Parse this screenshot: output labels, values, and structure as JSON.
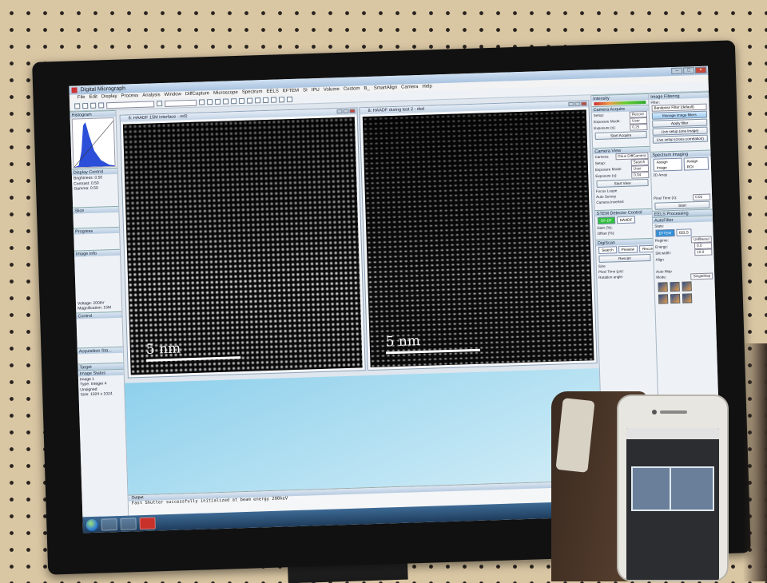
{
  "app": {
    "title": "Digital Micrograph",
    "menu": [
      "File",
      "Edit",
      "Display",
      "Process",
      "Analysis",
      "Window",
      "DiffCapture",
      "Microscope",
      "Spectrum",
      "EELS",
      "EFTEM",
      "SI",
      "IPU",
      "Volume",
      "Custom",
      "B_",
      "SmartAlign",
      "Camera",
      "Help"
    ]
  },
  "left_palettes": {
    "histogram": "Histogram",
    "display_control": "Display Control",
    "brightness": "Brightness: 0.50",
    "contrast": "Contrast: 0.50",
    "gamma": "Gamma: 0.50",
    "slice": "Slice",
    "progress": "Progress",
    "image_info": "Image Info",
    "voltage": "Voltage: 200kV",
    "magnification": "Magnification: 15M",
    "control": "Control",
    "acquisition_state": "Acquisition Sta...",
    "target": "Target",
    "image_status": "Image Status",
    "image_name": "Image 1",
    "image_type": "Type: Integer 4 Unsigned",
    "image_size": "Size: 1024 x 1024"
  },
  "windows": [
    {
      "title": "6: HAADF 15M interface - ref2",
      "scale_label": "5 nm"
    },
    {
      "title": "8: HAADF during test 2 - dsd",
      "scale_label": "5 nm"
    }
  ],
  "middle_panels": {
    "intensity": "Intensity",
    "camera_acquire": "Camera Acquire",
    "setup": "Setup:",
    "setup_value": "Record",
    "exposure_mode": "Exposure Mode:",
    "exposure_mode_value": "User",
    "exposure_s": "Exposure (s):",
    "exposure_value": "0.25",
    "start_acquire": "Start Acquire",
    "camera_view": "Camera View",
    "camera": "Camera:",
    "camera_value": "Orius DiffCamera",
    "view_setup_value": "Search",
    "view_exposure_value": "0.04",
    "start_view": "Start View",
    "focus_loupe": "Focus Loupe",
    "auto_survey": "Auto Survey",
    "camera_inserted": "Camera Inserted",
    "stem_detector": "STEM Detector Control",
    "df": "DF-DF",
    "haadf": "HAADF",
    "gain": "Gain (%):",
    "offset": "Offset (%):",
    "digiscan": "DigiScan",
    "search": "Search",
    "preview": "Preview",
    "record": "Record",
    "rescan": "Rescan",
    "size": "Size",
    "pixel_time": "Pixel Time (µs):",
    "rotation": "Rotation angle:"
  },
  "right_panels": {
    "image_filtering": "Image Filtering",
    "filter": "Filter:",
    "filter_value": "Bandpass Filter (default)",
    "manage": "Manage image filters",
    "apply": "Apply filter",
    "live_setup": "Live setup (one image)",
    "live_setup_cross": "Live setup (cross correlation)",
    "spectrum_imaging": "Spectrum Imaging",
    "assign_image": "Assign Image",
    "assign_roi": "Assign ROI",
    "array_2d": "2D Array",
    "pixel_time": "Pixel Time (s):",
    "pixel_time_value": "0.05",
    "start": "Start",
    "eels_processing": "EELS Processing",
    "autofilter": "AutoFilter",
    "state": "State:",
    "eftem": "EFTEM",
    "eels": "EELS",
    "regime": "Regime:",
    "regime_value": "Unfiltered",
    "energy": "Energy:",
    "energy_value": "0.0",
    "slit_width": "Slit width:",
    "slit_value": "10.0",
    "align": "Align",
    "auto_map": "Auto Map",
    "mode": "Mode:",
    "mode_value": "SingleMap"
  },
  "output": {
    "title": "Output",
    "lines": [
      "Fast Shutter successfully initialized at beam energy 200keV"
    ]
  },
  "colors": {
    "titlebar": "#a9c3e0",
    "taskbar": "#1f3c5c",
    "close_button": "#c8473a",
    "acquire_green": "#2fbf3b"
  },
  "icons": [
    "start-orb-icon",
    "folder-icon",
    "media-icon",
    "digital-micrograph-icon"
  ]
}
